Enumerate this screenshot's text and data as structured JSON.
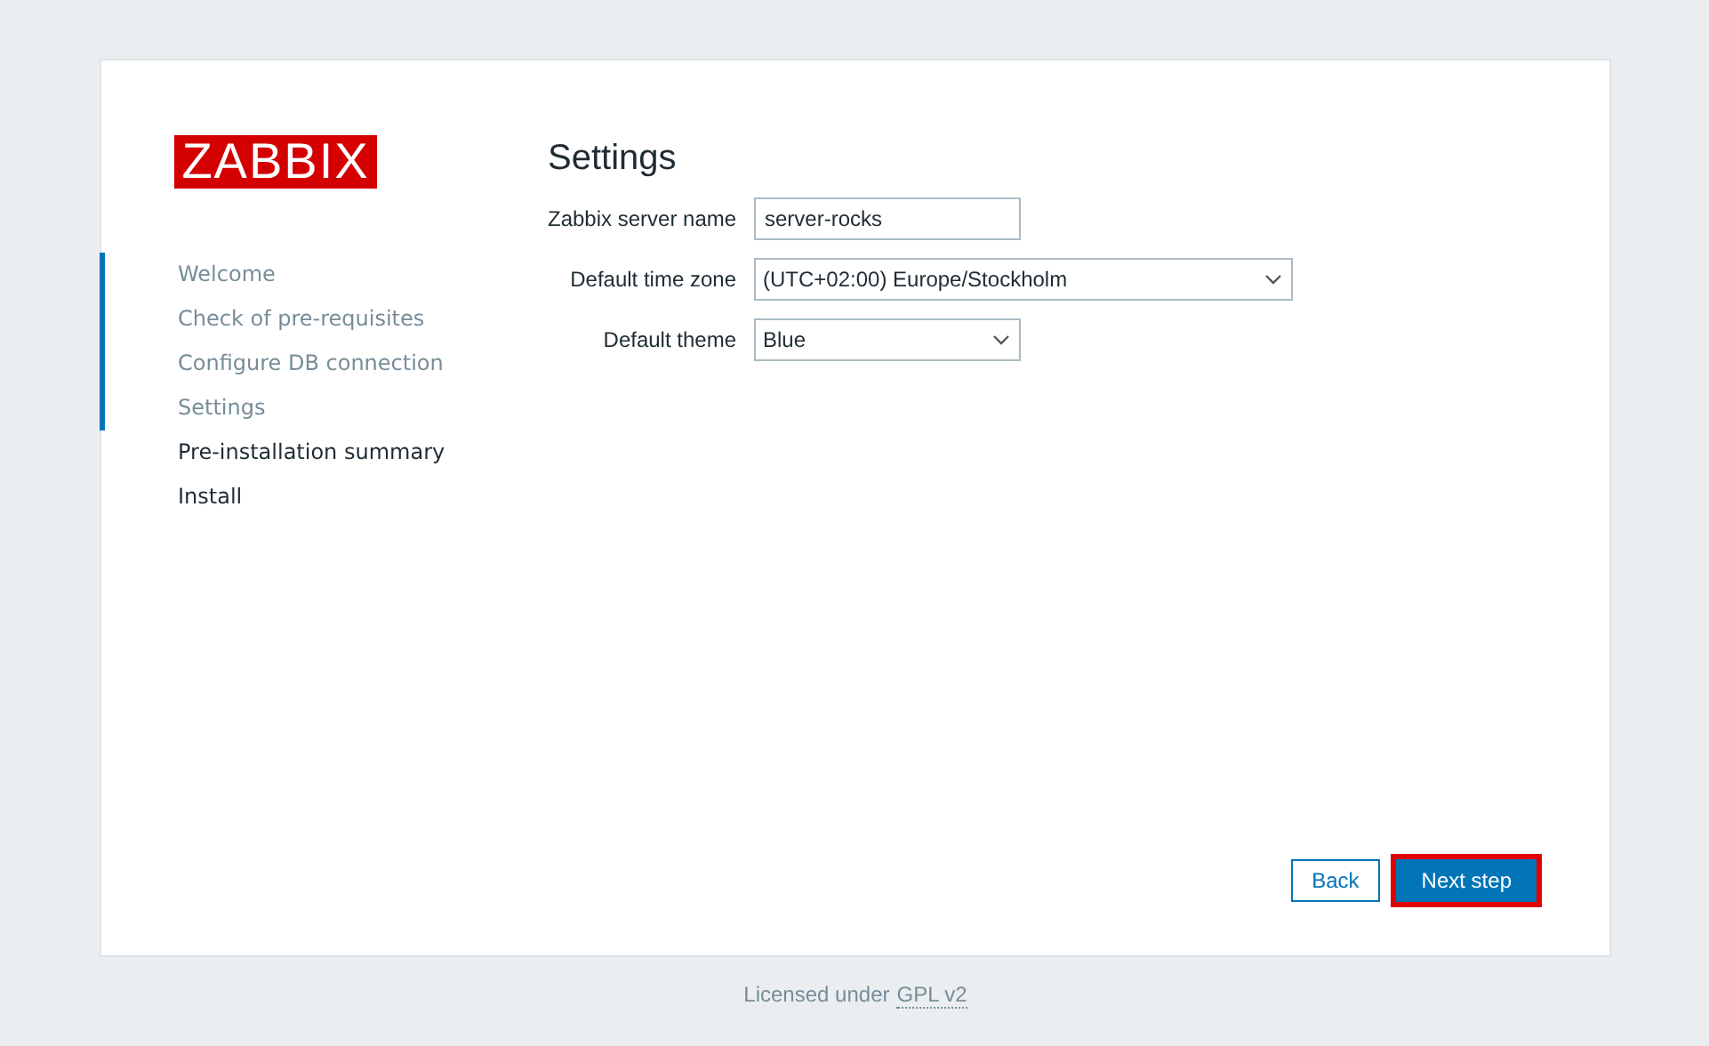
{
  "logo": {
    "text": "ZABBIX"
  },
  "steps": [
    {
      "label": "Welcome",
      "done": true
    },
    {
      "label": "Check of pre-requisites",
      "done": true
    },
    {
      "label": "Configure DB connection",
      "done": true
    },
    {
      "label": "Settings",
      "done": true
    },
    {
      "label": "Pre-installation summary",
      "done": false
    },
    {
      "label": "Install",
      "done": false
    }
  ],
  "heading": "Settings",
  "fields": [
    {
      "kind": "text",
      "label": "Zabbix server name",
      "value": "server-rocks",
      "wide": false
    },
    {
      "kind": "select",
      "label": "Default time zone",
      "value": "(UTC+02:00) Europe/Stockholm",
      "wide": true
    },
    {
      "kind": "select",
      "label": "Default theme",
      "value": "Blue",
      "wide": false
    }
  ],
  "buttons": [
    {
      "label": "Back",
      "kind": "secondary",
      "highlighted": false
    },
    {
      "label": "Next step",
      "kind": "primary",
      "highlighted": true
    }
  ],
  "footer": {
    "text": "Licensed under",
    "link": "GPL v2"
  }
}
